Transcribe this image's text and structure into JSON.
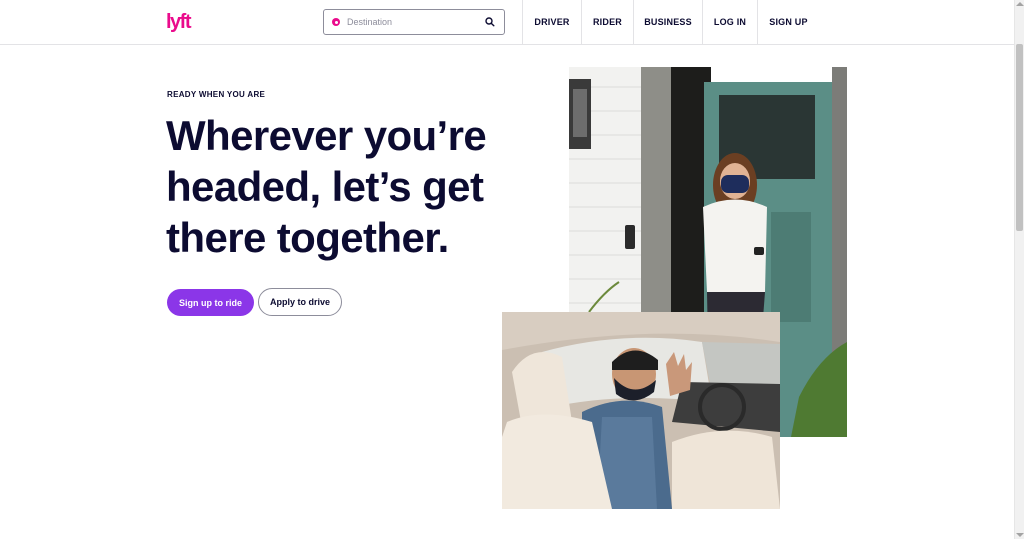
{
  "header": {
    "logo_text": "lyft",
    "search": {
      "placeholder": "Destination"
    },
    "nav": [
      {
        "label": "DRIVER"
      },
      {
        "label": "RIDER"
      },
      {
        "label": "BUSINESS"
      },
      {
        "label": "LOG IN"
      },
      {
        "label": "SIGN UP"
      }
    ]
  },
  "hero": {
    "eyebrow": "READY WHEN YOU ARE",
    "headline": "Wherever you’re headed, let’s get there together.",
    "buttons": {
      "primary": "Sign up to ride",
      "secondary": "Apply to drive"
    }
  },
  "colors": {
    "brand_pink": "#ea0b8c",
    "brand_purple": "#8b36e8",
    "text_dark": "#0c0b31",
    "border_gray": "#e3e3e6"
  },
  "icons": [
    "lyft-logo",
    "location-dot-icon",
    "search-icon"
  ]
}
